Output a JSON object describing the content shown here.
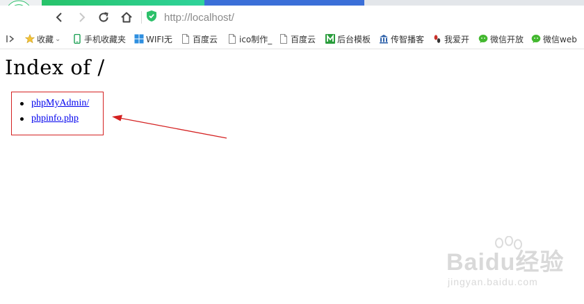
{
  "browser": {
    "url": "http://localhost/"
  },
  "bookmarks": [
    {
      "label": "收藏",
      "icon": "star-icon",
      "chevron": "⌄"
    },
    {
      "label": "手机收藏夹",
      "icon": "phone-icon"
    },
    {
      "label": "WIFI无",
      "icon": "windows-icon"
    },
    {
      "label": "百度云",
      "icon": "page-icon"
    },
    {
      "label": "ico制作_",
      "icon": "page-icon"
    },
    {
      "label": "百度云",
      "icon": "page-icon"
    },
    {
      "label": "后台模板",
      "icon": "m-icon"
    },
    {
      "label": "传智播客",
      "icon": "bank-icon"
    },
    {
      "label": "我爱开",
      "icon": "footprint-icon"
    },
    {
      "label": "微信开放",
      "icon": "wechat-icon"
    },
    {
      "label": "微信web",
      "icon": "wechat-icon"
    }
  ],
  "page": {
    "title": "Index of /",
    "links": [
      "phpMyAdmin/",
      "phpinfo.php"
    ]
  },
  "watermark": {
    "brand": "Baidu经验",
    "url": "jingyan.baidu.com"
  },
  "colors": {
    "tab_accent": "#27c36a",
    "tab_blue": "#3b6fd8",
    "link": "#0000ee",
    "annotation": "#d42020"
  }
}
